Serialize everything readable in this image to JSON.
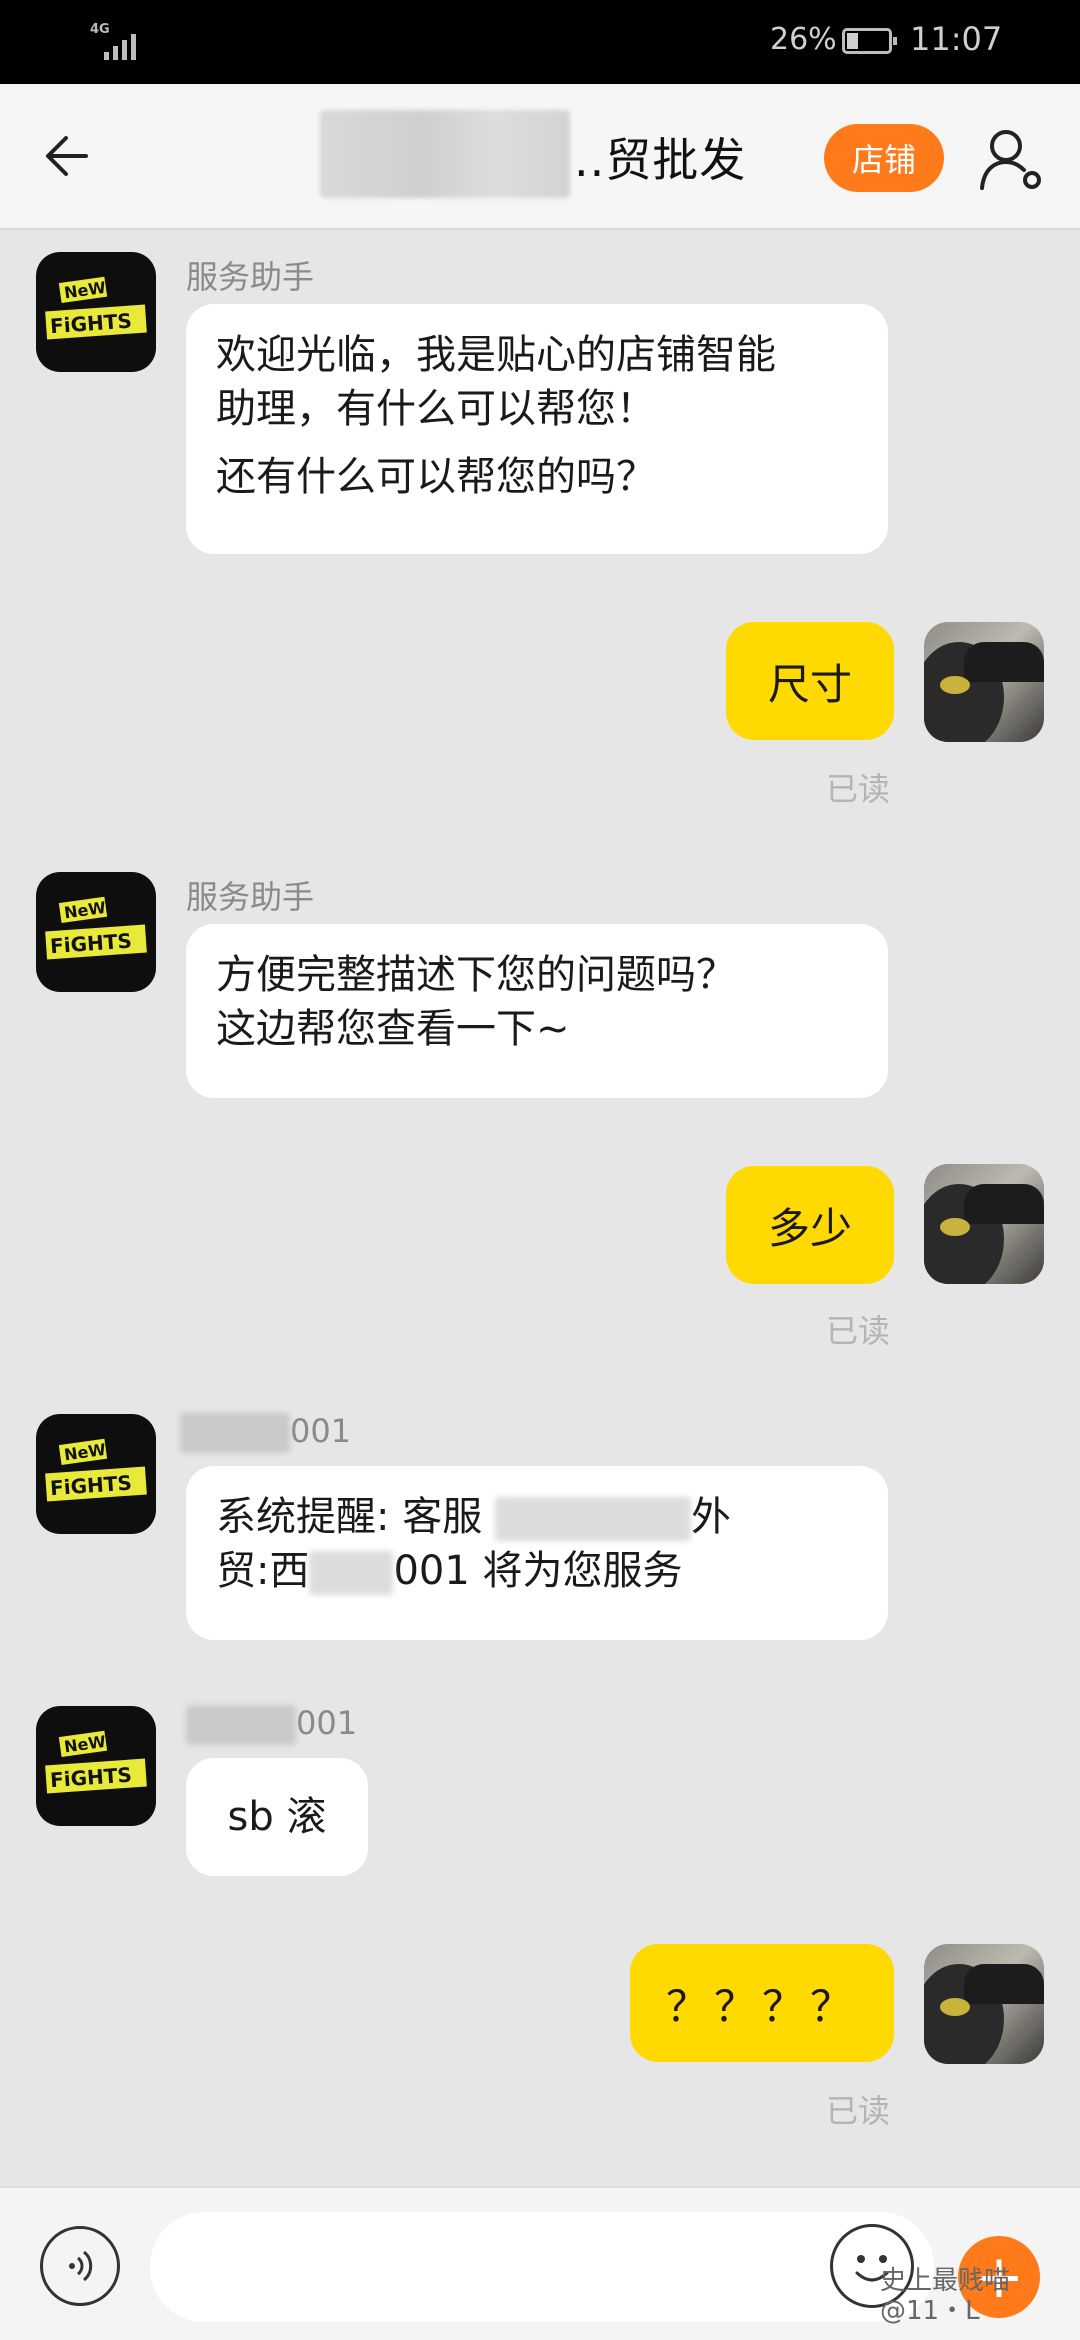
{
  "status_bar": {
    "network": "4G",
    "battery_percent": "26%",
    "battery_level": 0.26,
    "time": "11:07"
  },
  "header": {
    "title_suffix": "..贸批发",
    "store_button": "店铺",
    "icons": [
      "back-arrow-icon",
      "user-settings-icon"
    ]
  },
  "messages": [
    {
      "sender": "服务助手",
      "lines": [
        "欢迎光临，我是贴心的店铺智能",
        "助理，有什么可以帮您！"
      ],
      "extra_line": "还有什么可以帮您的吗？"
    },
    {
      "text": "尺寸",
      "status": "已读"
    },
    {
      "sender": "服务助手",
      "lines": [
        "方便完整描述下您的问题吗？",
        "这边帮您查看一下~"
      ]
    },
    {
      "text": "多少",
      "status": "已读"
    },
    {
      "sender_visible": "001",
      "line1_a": "系统提醒: 客服",
      "line1_b": "外",
      "line2_a": "贸:西",
      "line2_b": "001 将为您服务"
    },
    {
      "sender_visible": "001",
      "text": "sb 滚"
    },
    {
      "text": "？？？？",
      "status": "已读"
    }
  ],
  "input_bar": {
    "icons": [
      "voice-icon",
      "emoji-icon",
      "plus-icon"
    ],
    "plus_label": "+"
  },
  "watermark": {
    "line1": "史上最贱喵",
    "line2": "@11・L"
  }
}
